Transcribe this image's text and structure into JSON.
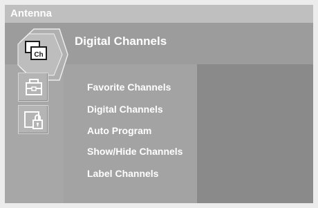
{
  "source": {
    "label": "Antenna"
  },
  "header": {
    "title": "Digital Channels"
  },
  "categories": [
    {
      "name": "channel",
      "icon": "channel-icon",
      "icon_text": "Ch",
      "selected": true
    },
    {
      "name": "setup",
      "icon": "toolbox-icon"
    },
    {
      "name": "lock",
      "icon": "lock-icon"
    }
  ],
  "menu": {
    "items": [
      {
        "label": "Favorite Channels"
      },
      {
        "label": "Digital Channels"
      },
      {
        "label": "Auto Program"
      },
      {
        "label": "Show/Hide Channels"
      },
      {
        "label": "Label Channels"
      }
    ]
  },
  "colors": {
    "panel": "#adadad",
    "header_band": "#9c9c9c",
    "content_pane": "#8a8a8a",
    "text": "#ffffff"
  }
}
